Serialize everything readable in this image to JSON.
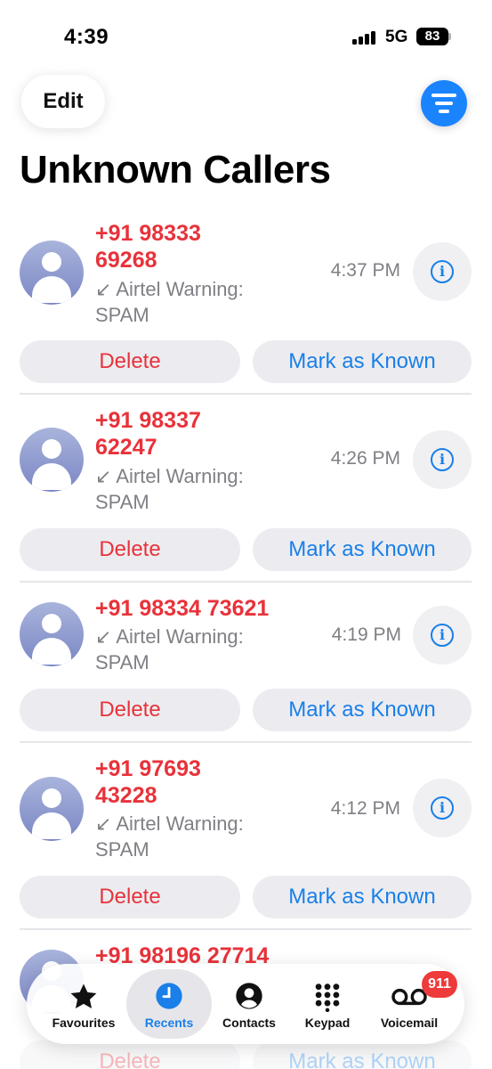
{
  "status_bar": {
    "time": "4:39",
    "network": "5G",
    "battery": "83"
  },
  "header": {
    "edit_label": "Edit",
    "title": "Unknown Callers"
  },
  "calls": [
    {
      "number_line1": "+91 98333",
      "number_line2": "69268",
      "warning_line1": "↙ Airtel Warning:",
      "warning_line2": "SPAM",
      "time": "4:37 PM",
      "delete_label": "Delete",
      "known_label": "Mark as Known"
    },
    {
      "number_line1": "+91 98337",
      "number_line2": "62247",
      "warning_line1": "↙ Airtel Warning:",
      "warning_line2": "SPAM",
      "time": "4:26 PM",
      "delete_label": "Delete",
      "known_label": "Mark as Known"
    },
    {
      "number_line1": "+91 98334 73621",
      "warning_line1": "↙ Airtel Warning:",
      "warning_line2": "SPAM",
      "time": "4:19 PM",
      "delete_label": "Delete",
      "known_label": "Mark as Known"
    },
    {
      "number_line1": "+91 97693",
      "number_line2": "43228",
      "warning_line1": "↙ Airtel Warning:",
      "warning_line2": "SPAM",
      "time": "4:12 PM",
      "delete_label": "Delete",
      "known_label": "Mark as Known"
    },
    {
      "number_line1": "+91 98196 27714",
      "delete_label": "Delete",
      "known_label": "Mark as Known"
    }
  ],
  "tab_bar": {
    "tabs": [
      {
        "label": "Favourites",
        "icon": "star-icon"
      },
      {
        "label": "Recents",
        "icon": "clock-icon",
        "active": true
      },
      {
        "label": "Contacts",
        "icon": "person-circle-icon"
      },
      {
        "label": "Keypad",
        "icon": "keypad-icon"
      },
      {
        "label": "Voicemail",
        "icon": "voicemail-icon"
      }
    ],
    "voicemail_badge": "911"
  },
  "colors": {
    "accent_blue": "#1a7fe8",
    "spam_red": "#e8323a",
    "filter_blue": "#1a84ff",
    "badge_red": "#ee3a3a"
  }
}
